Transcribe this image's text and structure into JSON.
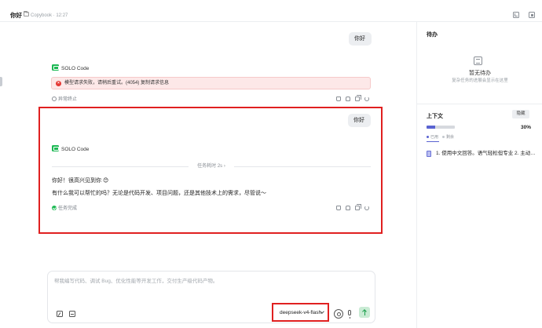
{
  "header": {
    "title": "你好",
    "project": "Copybook · 12:27",
    "icons": [
      "terminal-icon",
      "panel-icon"
    ]
  },
  "chat": {
    "user_message_1": "你好",
    "agent_name": "SOLO Code",
    "error_text": "模型请求失败，请稍后重试。(4054) 复制请求信息",
    "status_aborted": "异常终止",
    "user_message_2": "你好",
    "task_elapsed": "任务耗时 2s ›",
    "reply_line_1": "你好！很高兴见到你 😊",
    "reply_line_2": "有什么我可以帮忙的吗？无论是代码开发、项目问题，还是其他技术上的需求，尽管说～",
    "status_done": "任务完成"
  },
  "composer": {
    "placeholder": "帮我编写代码、调试 Bug、优化性能等开发工作，交付生产级代码产物。",
    "model": "deepseek-v4-flash"
  },
  "right_panel": {
    "todo_title": "待办",
    "todo_empty_title": "暂无待办",
    "todo_empty_sub": "复杂任务的进展会显示在这里",
    "context_title": "上下文",
    "collapse_label": "隐藏",
    "usage_fraction": 0.3,
    "usage_percent_label": "30%",
    "legend_used": "已用",
    "legend_free": "剩余",
    "context_item": "1. 使用中文回答。语气轻松但专业 2. 主动…"
  },
  "colors": {
    "accent_green": "#1db954",
    "highlight_red": "#e02020",
    "progress_purple": "#5a63d1",
    "error_bg": "#fde8e8"
  }
}
